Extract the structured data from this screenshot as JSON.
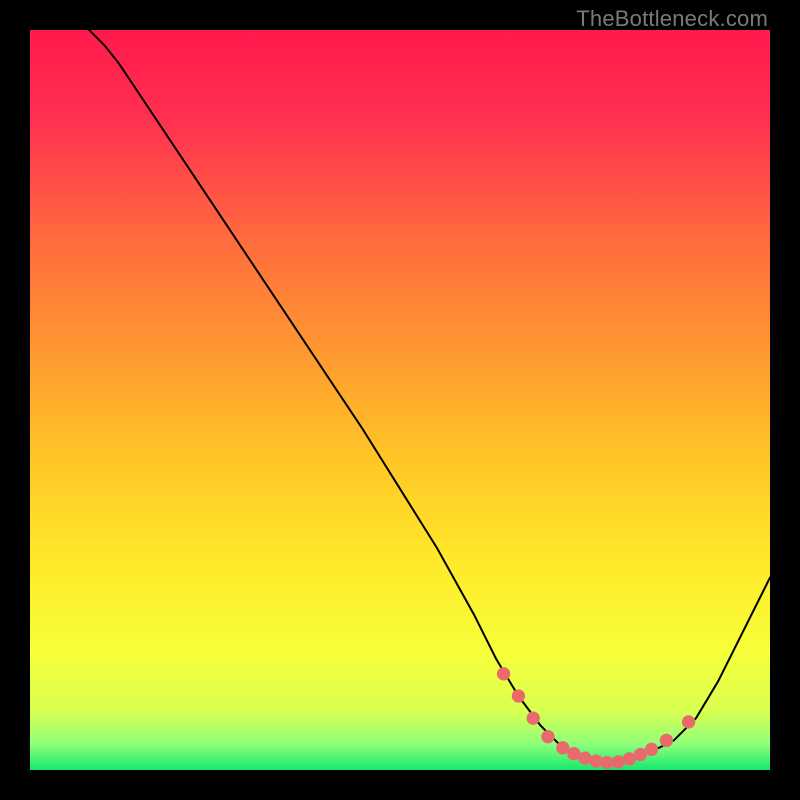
{
  "watermark": "TheBottleneck.com",
  "gradient_stops": [
    {
      "offset": 0.0,
      "color": "#ff1a4d"
    },
    {
      "offset": 0.12,
      "color": "#ff3050"
    },
    {
      "offset": 0.28,
      "color": "#ff6a3e"
    },
    {
      "offset": 0.44,
      "color": "#ff9a30"
    },
    {
      "offset": 0.58,
      "color": "#ffc626"
    },
    {
      "offset": 0.72,
      "color": "#ffe92a"
    },
    {
      "offset": 0.84,
      "color": "#f7ff3a"
    },
    {
      "offset": 0.92,
      "color": "#d9ff50"
    },
    {
      "offset": 0.965,
      "color": "#8fff7a"
    },
    {
      "offset": 1.0,
      "color": "#16e86e"
    }
  ],
  "chart_data": {
    "type": "line",
    "title": "",
    "xlabel": "",
    "ylabel": "",
    "xlim": [
      0,
      100
    ],
    "ylim": [
      0,
      100
    ],
    "grid": false,
    "series": [
      {
        "name": "bottleneck-curve",
        "x": [
          8,
          10,
          12,
          15,
          20,
          25,
          30,
          35,
          40,
          45,
          50,
          55,
          60,
          63,
          66,
          69,
          72,
          75,
          78,
          81,
          84,
          87,
          90,
          93,
          96,
          100
        ],
        "y": [
          100,
          98,
          95.5,
          91,
          83.5,
          76,
          68.5,
          61,
          53.5,
          46,
          38,
          30,
          21,
          15,
          10,
          6,
          3,
          1.5,
          1,
          1.5,
          2.5,
          4,
          7,
          12,
          18,
          26
        ]
      }
    ],
    "markers": {
      "name": "highlight-dots",
      "color": "#e86a6a",
      "points": [
        {
          "x": 64,
          "y": 13
        },
        {
          "x": 66,
          "y": 10
        },
        {
          "x": 68,
          "y": 7
        },
        {
          "x": 70,
          "y": 4.5
        },
        {
          "x": 72,
          "y": 3
        },
        {
          "x": 73.5,
          "y": 2.2
        },
        {
          "x": 75,
          "y": 1.6
        },
        {
          "x": 76.5,
          "y": 1.2
        },
        {
          "x": 78,
          "y": 1
        },
        {
          "x": 79.5,
          "y": 1.1
        },
        {
          "x": 81,
          "y": 1.5
        },
        {
          "x": 82.5,
          "y": 2.1
        },
        {
          "x": 84,
          "y": 2.8
        },
        {
          "x": 86,
          "y": 4
        },
        {
          "x": 89,
          "y": 6.5
        }
      ]
    }
  }
}
